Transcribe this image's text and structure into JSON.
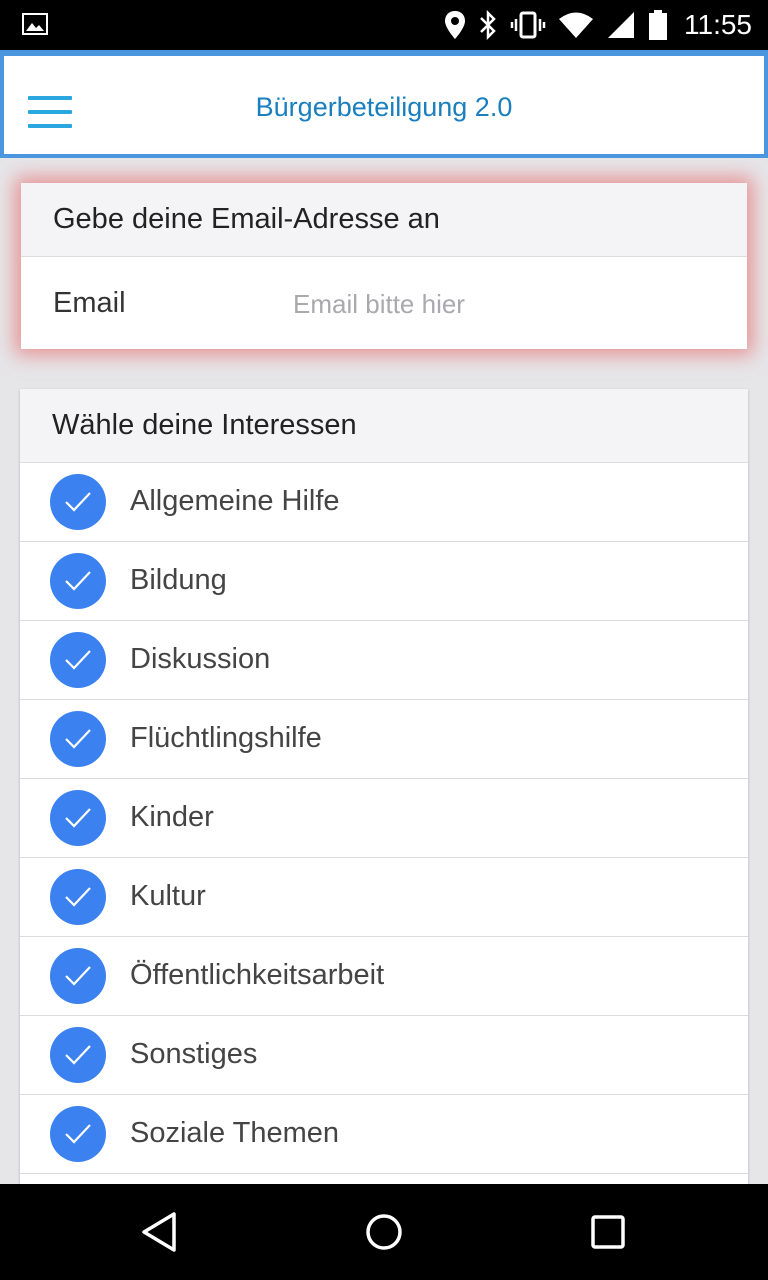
{
  "status_bar": {
    "time": "11:55",
    "icons": [
      "image-icon",
      "location-icon",
      "bluetooth-icon",
      "vibrate-icon",
      "wifi-icon",
      "signal-icon",
      "battery-icon"
    ]
  },
  "header": {
    "title": "Bürgerbeteiligung 2.0",
    "menu_icon": "hamburger-menu-icon",
    "accent_color": "#4a97e0",
    "title_color": "#1a7fbe"
  },
  "email_section": {
    "heading": "Gebe deine Email-Adresse an",
    "label": "Email",
    "placeholder": "Email bitte hier",
    "value": "",
    "highlight_color": "#e85050"
  },
  "interests_section": {
    "heading": "Wähle deine Interessen",
    "check_color": "#3b82f0",
    "items": [
      {
        "label": "Allgemeine Hilfe",
        "checked": true
      },
      {
        "label": "Bildung",
        "checked": true
      },
      {
        "label": "Diskussion",
        "checked": true
      },
      {
        "label": "Flüchtlingshilfe",
        "checked": true
      },
      {
        "label": "Kinder",
        "checked": true
      },
      {
        "label": "Kultur",
        "checked": true
      },
      {
        "label": "Öffentlichkeitsarbeit",
        "checked": true
      },
      {
        "label": "Sonstiges",
        "checked": true
      },
      {
        "label": "Soziale Themen",
        "checked": true
      }
    ]
  },
  "nav_bar": {
    "buttons": [
      "back-icon",
      "home-icon",
      "recents-icon"
    ]
  }
}
